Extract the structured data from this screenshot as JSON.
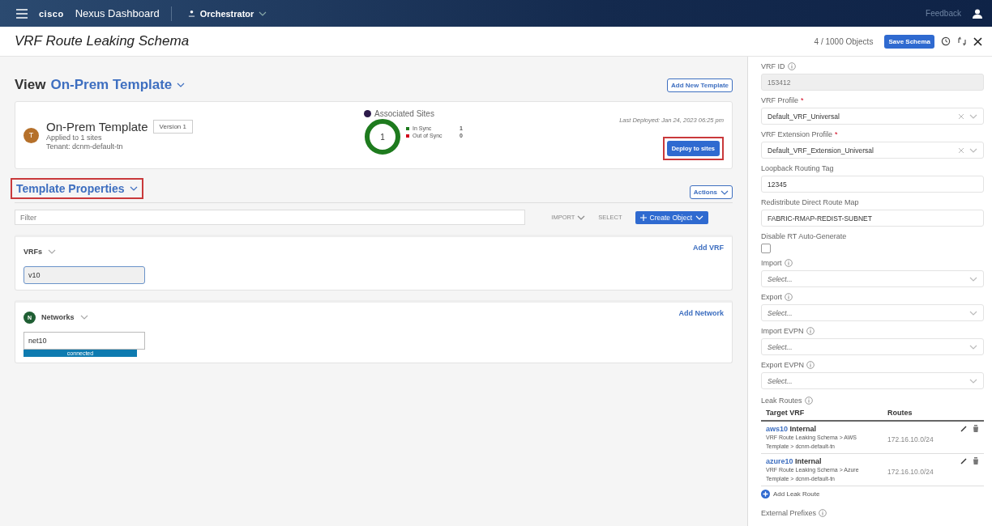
{
  "topbar": {
    "brand": "cisco",
    "product": "Nexus Dashboard",
    "app": "Orchestrator",
    "feedback": "Feedback"
  },
  "header": {
    "title": "VRF Route Leaking Schema",
    "objects": "4 / 1000 Objects",
    "save": "Save Schema"
  },
  "view": {
    "label": "View",
    "template": "On-Prem Template",
    "add_template": "Add New Template"
  },
  "template_card": {
    "avatar": "T",
    "name": "On-Prem Template",
    "version": "Version 1",
    "applied": "Applied to 1 sites",
    "tenant": "Tenant: dcnm-default-tn",
    "sites_title": "Associated Sites",
    "sites_count": "1",
    "legend": [
      {
        "label": "In Sync",
        "count": "1",
        "color": "#1e7b1e"
      },
      {
        "label": "Out of Sync",
        "count": "0",
        "color": "#d0021b"
      }
    ],
    "last_deployed": "Last Deployed: Jan 24, 2023 06:25 pm",
    "deploy": {
      "label": "Deploy to sites",
      "highlighted": true
    }
  },
  "properties": {
    "title": "Template Properties",
    "highlighted": true,
    "actions": "Actions",
    "filter_placeholder": "Filter",
    "import": "IMPORT",
    "select": "SELECT",
    "create": "Create Object"
  },
  "sections": [
    {
      "title": "VRFs",
      "add": "Add VRF",
      "items": [
        {
          "label": "v10",
          "selected": true
        }
      ]
    },
    {
      "title": "Networks",
      "badge": "N",
      "add": "Add Network",
      "items": [
        {
          "label": "net10",
          "selected": false,
          "status": "connected"
        }
      ]
    }
  ],
  "panel": {
    "fields": [
      {
        "kind": "readonly",
        "label": "VRF ID",
        "info": true,
        "value": "153412"
      },
      {
        "kind": "select",
        "label": "VRF Profile",
        "info": false,
        "required_mark": "*",
        "value": "Default_VRF_Universal"
      },
      {
        "kind": "select",
        "label": "VRF Extension Profile",
        "info": false,
        "required_mark": "*",
        "value": "Default_VRF_Extension_Universal"
      },
      {
        "kind": "input",
        "label": "Loopback Routing Tag",
        "info": false,
        "value": "12345"
      },
      {
        "kind": "input",
        "label": "Redistribute Direct Route Map",
        "info": false,
        "value": "FABRIC-RMAP-REDIST-SUBNET"
      },
      {
        "kind": "checkbox",
        "label": "Disable RT Auto-Generate",
        "info": false,
        "checked": false
      },
      {
        "kind": "placeholder",
        "label": "Import",
        "info": true,
        "placeholder": "Select..."
      },
      {
        "kind": "placeholder",
        "label": "Export",
        "info": true,
        "placeholder": "Select..."
      },
      {
        "kind": "placeholder",
        "label": "Import EVPN",
        "info": true,
        "placeholder": "Select..."
      },
      {
        "kind": "placeholder",
        "label": "Export EVPN",
        "info": true,
        "placeholder": "Select..."
      }
    ],
    "leak": {
      "label": "Leak Routes",
      "columns": [
        "Target VRF",
        "Routes"
      ],
      "rows": [
        {
          "vrf": "aws10",
          "type": "Internal",
          "path1": "VRF Route Leaking Schema > AWS",
          "path2": "Template > dcnm-default-tn",
          "route": "172.16.10.0/24"
        },
        {
          "vrf": "azure10",
          "type": "Internal",
          "path1": "VRF Route Leaking Schema > Azure",
          "path2": "Template > dcnm-default-tn",
          "route": "172.16.10.0/24"
        }
      ],
      "add": "Add Leak Route"
    },
    "external": "External Prefixes"
  }
}
